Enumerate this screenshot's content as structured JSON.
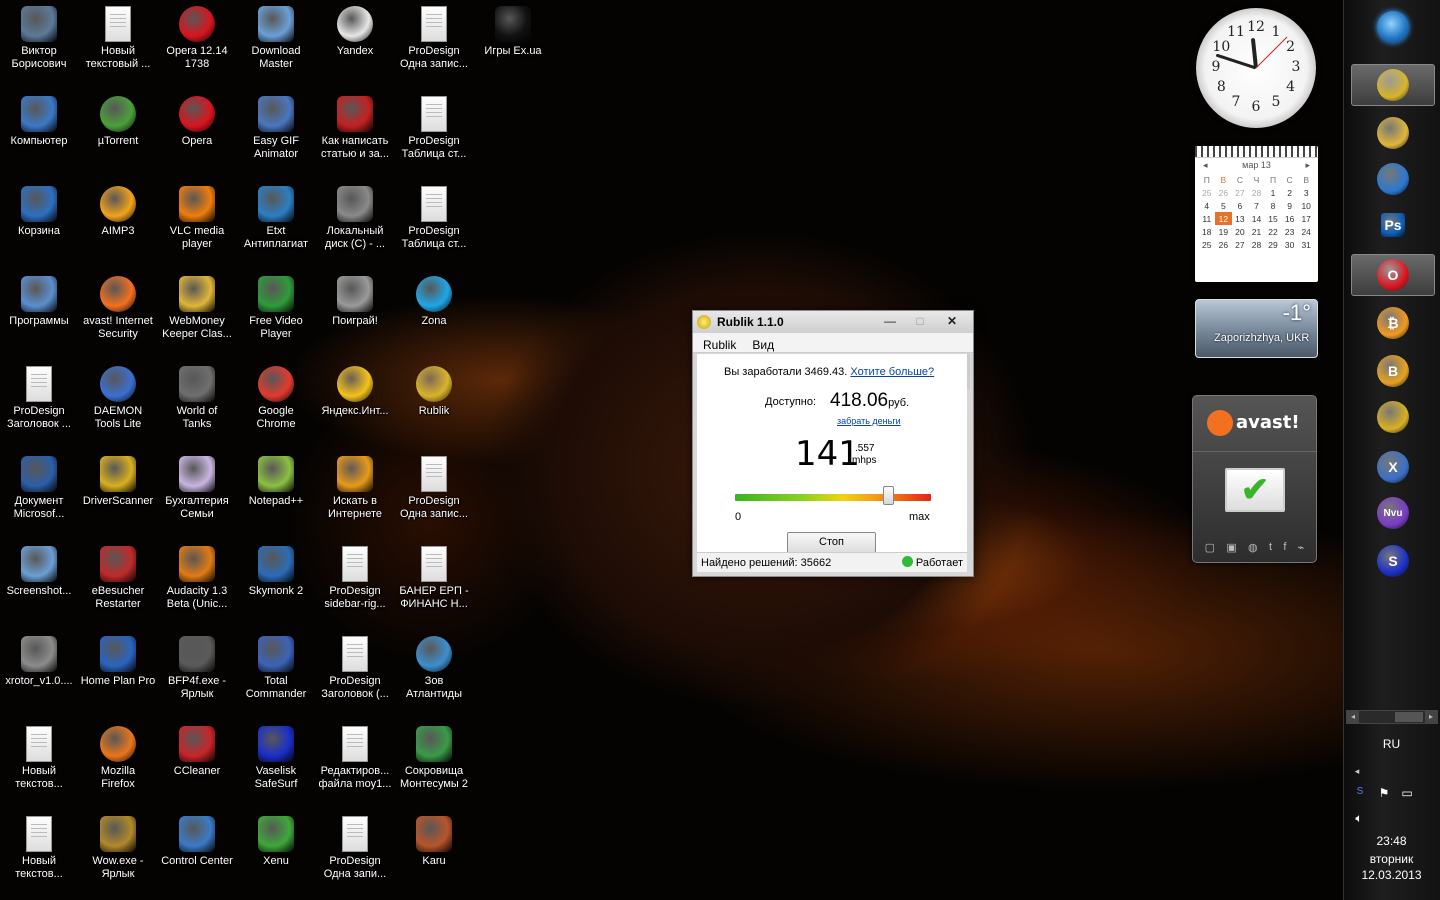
{
  "desktop_icons": [
    {
      "label": "Виктор\nБорисович",
      "icon": "user-folder-icon",
      "color": "#5b7a99"
    },
    {
      "label": "Новый\nтекстовый ...",
      "icon": "text-document-icon",
      "color": "doc"
    },
    {
      "label": "Opera 12.14\n1738",
      "icon": "opera-icon",
      "color": "#d9141e"
    },
    {
      "label": "Download\nMaster",
      "icon": "download-master-icon",
      "color": "#6aa0d6"
    },
    {
      "label": "Yandex",
      "icon": "yandex-browser-icon",
      "color": "#e7e7e7"
    },
    {
      "label": "ProDesign\nОдна запис...",
      "icon": "text-document-icon",
      "color": "doc"
    },
    {
      "label": "Игры Ex.ua",
      "icon": "exua-icon",
      "color": "#111111"
    },
    {
      "label": "Компьютер",
      "icon": "computer-icon",
      "color": "#3b79c7"
    },
    {
      "label": "µTorrent",
      "icon": "utorrent-icon",
      "color": "#4aa13a"
    },
    {
      "label": "Opera",
      "icon": "opera-icon",
      "color": "#d9141e"
    },
    {
      "label": "Easy GIF\nAnimator",
      "icon": "easy-gif-animator-icon",
      "color": "#4a77c0"
    },
    {
      "label": "Как написать\nстатью и за...",
      "icon": "book-icon",
      "color": "#c42121"
    },
    {
      "label": "ProDesign\nТаблица ст...",
      "icon": "text-document-icon",
      "color": "doc"
    },
    {
      "label": "Корзина",
      "icon": "recycle-bin-icon",
      "color": "#2d6fc1"
    },
    {
      "label": "AIMP3",
      "icon": "aimp-icon",
      "color": "#f2a31b"
    },
    {
      "label": "VLC media\nplayer",
      "icon": "vlc-icon",
      "color": "#f07d0c"
    },
    {
      "label": "Etxt\nАнтиплагиат",
      "icon": "etxt-icon",
      "color": "#2b7fc4"
    },
    {
      "label": "Локальный\nдиск (С) - ...",
      "icon": "local-disk-icon",
      "color": "#8a8a8a"
    },
    {
      "label": "ProDesign\nТаблица ст...",
      "icon": "text-document-icon",
      "color": "doc"
    },
    {
      "label": "Программы",
      "icon": "programs-folder-icon",
      "color": "#5b8fd0"
    },
    {
      "label": "avast! Internet\nSecurity",
      "icon": "avast-icon",
      "color": "#f37021"
    },
    {
      "label": "WebMoney\nKeeper Clas...",
      "icon": "webmoney-icon",
      "color": "#e0b63a"
    },
    {
      "label": "Free Video\nPlayer",
      "icon": "free-video-player-icon",
      "color": "#2e9b3a"
    },
    {
      "label": "Поиграй!",
      "icon": "gamepad-icon",
      "color": "#9a9a9a"
    },
    {
      "label": "Zona",
      "icon": "zona-icon",
      "color": "#1ea7e8"
    },
    {
      "label": "ProDesign\nЗаголовок ...",
      "icon": "text-document-icon",
      "color": "doc"
    },
    {
      "label": "DAEMON\nTools Lite",
      "icon": "daemon-tools-icon",
      "color": "#3b6fd2"
    },
    {
      "label": "World of\nTanks",
      "icon": "world-of-tanks-icon",
      "color": "#6f6f6f"
    },
    {
      "label": "Google\nChrome",
      "icon": "chrome-icon",
      "color": "#e23a2e"
    },
    {
      "label": "Яндекс.Инт...",
      "icon": "yandex-internet-icon",
      "color": "#f3c21a"
    },
    {
      "label": "Rublik",
      "icon": "rublik-coin-icon",
      "color": "#d8b42a"
    },
    {
      "label": "Документ\nMicrosof...",
      "icon": "word-document-icon",
      "color": "#2c5ea8"
    },
    {
      "label": "DriverScanner",
      "icon": "driverscanner-icon",
      "color": "#d9b020"
    },
    {
      "label": "Бухгалтерия\nСемьи",
      "icon": "accounting-icon",
      "color": "#c9b6e2"
    },
    {
      "label": "Notepad++",
      "icon": "notepad-plus-plus-icon",
      "color": "#8cc043"
    },
    {
      "label": "Искать в\nИнтернете",
      "icon": "search-web-icon",
      "color": "#e79a1a"
    },
    {
      "label": "ProDesign\nОдна запис...",
      "icon": "text-document-icon",
      "color": "doc"
    },
    {
      "label": "Screenshot...",
      "icon": "screenshot-icon",
      "color": "#6b9fd4"
    },
    {
      "label": "eBesucher\nRestarter",
      "icon": "ebesucher-icon",
      "color": "#c12a2a"
    },
    {
      "label": "Audacity 1.3\nBeta (Unic...",
      "icon": "audacity-icon",
      "color": "#e27a14"
    },
    {
      "label": "Skymonk 2",
      "icon": "skymonk-icon",
      "color": "#2b6cb8"
    },
    {
      "label": "ProDesign\nsidebar-rig...",
      "icon": "text-document-icon",
      "color": "doc"
    },
    {
      "label": "БАНЕР ЕРП -\nФИНАНС Н...",
      "icon": "text-document-icon",
      "color": "doc"
    },
    {
      "label": "xrotor_v1.0....",
      "icon": "xrotor-icon",
      "color": "#8c8c8c"
    },
    {
      "label": "Home Plan Pro",
      "icon": "home-plan-pro-icon",
      "color": "#2a64c0"
    },
    {
      "label": "BFP4f.exe -\nЯрлык",
      "icon": "bfp4f-icon",
      "color": "#5a5a5a"
    },
    {
      "label": "Total\nCommander",
      "icon": "total-commander-icon",
      "color": "#3b63b8"
    },
    {
      "label": "ProDesign\nЗаголовок (...",
      "icon": "text-document-icon",
      "color": "doc"
    },
    {
      "label": "Зов\nАтлантиды",
      "icon": "atlantis-icon",
      "color": "#3c8fd0"
    },
    {
      "label": "Новый\nтекстов...",
      "icon": "text-document-icon",
      "color": "doc"
    },
    {
      "label": "Mozilla\nFirefox",
      "icon": "firefox-icon",
      "color": "#e9761b"
    },
    {
      "label": "CCleaner",
      "icon": "ccleaner-icon",
      "color": "#c8252a"
    },
    {
      "label": "Vaselisk\nSafeSurf",
      "icon": "safesurf-icon",
      "color": "#1a2fc9"
    },
    {
      "label": "Редактиров...\nфайла moy1...",
      "icon": "text-document-icon",
      "color": "doc"
    },
    {
      "label": "Сокровища\nМонтесумы 2",
      "icon": "montezuma-icon",
      "color": "#3a9a48"
    },
    {
      "label": "Новый\nтекстов...",
      "icon": "text-document-icon",
      "color": "doc"
    },
    {
      "label": "Wow.exe -\nЯрлык",
      "icon": "world-of-warcraft-icon",
      "color": "#b08a2a"
    },
    {
      "label": "Control Center",
      "icon": "control-center-icon",
      "color": "#3a7bc8"
    },
    {
      "label": "Xenu",
      "icon": "xenu-icon",
      "color": "#3ea83a"
    },
    {
      "label": "ProDesign\nОдна запи...",
      "icon": "text-document-icon",
      "color": "doc"
    },
    {
      "label": "Karu",
      "icon": "karu-icon",
      "color": "#b8552a"
    }
  ],
  "clock": {
    "hour": 11,
    "minute": 48,
    "numerals": [
      "12",
      "1",
      "2",
      "3",
      "4",
      "5",
      "6",
      "7",
      "8",
      "9",
      "10",
      "11"
    ]
  },
  "calendar": {
    "month_label": "мар 13",
    "weekdays": [
      "П",
      "В",
      "С",
      "Ч",
      "П",
      "С",
      "В"
    ],
    "weeks": [
      [
        "25",
        "26",
        "27",
        "28",
        "1",
        "2",
        "3"
      ],
      [
        "4",
        "5",
        "6",
        "7",
        "8",
        "9",
        "10"
      ],
      [
        "11",
        "12",
        "13",
        "14",
        "15",
        "16",
        "17"
      ],
      [
        "18",
        "19",
        "20",
        "21",
        "22",
        "23",
        "24"
      ],
      [
        "25",
        "26",
        "27",
        "28",
        "29",
        "30",
        "31"
      ]
    ],
    "today": "12"
  },
  "weather": {
    "temperature": "-1°",
    "city": "Zaporizhzhya, UKR"
  },
  "avast_gadget": {
    "brand": "avast!",
    "status_icon": "checkmark-icon"
  },
  "taskbar": {
    "buttons": [
      {
        "icon": "windows-start-icon",
        "color": "#1c6fbf",
        "glyph": ""
      },
      {
        "icon": "rublik-coin-icon",
        "color": "#d8b42a",
        "glyph": "",
        "active": true
      },
      {
        "icon": "webmoney-icon",
        "color": "#e0b63a",
        "glyph": ""
      },
      {
        "icon": "daemon-tools-icon",
        "color": "#2a78d2",
        "glyph": ""
      },
      {
        "icon": "photoshop-icon",
        "color": "#0a5db8",
        "glyph": "Ps"
      },
      {
        "icon": "opera-icon",
        "color": "#d9141e",
        "glyph": "O",
        "active": true
      },
      {
        "icon": "bitcoin-icon",
        "color": "#f29a1f",
        "glyph": "₿"
      },
      {
        "icon": "bitcoin-icon",
        "color": "#e8a31e",
        "glyph": "B"
      },
      {
        "icon": "driverscanner-icon",
        "color": "#d9b020",
        "glyph": ""
      },
      {
        "icon": "xrotor-icon",
        "color": "#3a70c8",
        "glyph": "X"
      },
      {
        "icon": "nvu-icon",
        "color": "#7a3ac8",
        "glyph": "Nvu"
      },
      {
        "icon": "safesurf-icon",
        "color": "#1a2fc9",
        "glyph": "S"
      }
    ],
    "language": "RU",
    "time": "23:48",
    "day": "вторник",
    "date": "12.03.2013"
  },
  "rublik_window": {
    "title": "Rublik 1.1.0",
    "menu": [
      "Rublik",
      "Вид"
    ],
    "earned_prefix": "Вы заработали 3469.43.",
    "earned_link": "Хотите больше?",
    "available_label": "Доступно:",
    "available_value": "418.06",
    "available_unit": "руб.",
    "withdraw_link": "забрать деньги",
    "speed_main": "141",
    "speed_fraction": ".557",
    "speed_unit": "mhps",
    "gauge_min": "0",
    "gauge_max": "max",
    "gauge_level": 0.78,
    "stop_button": "Стоп",
    "found_label": "Найдено решений: 35662",
    "status": "Работает"
  }
}
